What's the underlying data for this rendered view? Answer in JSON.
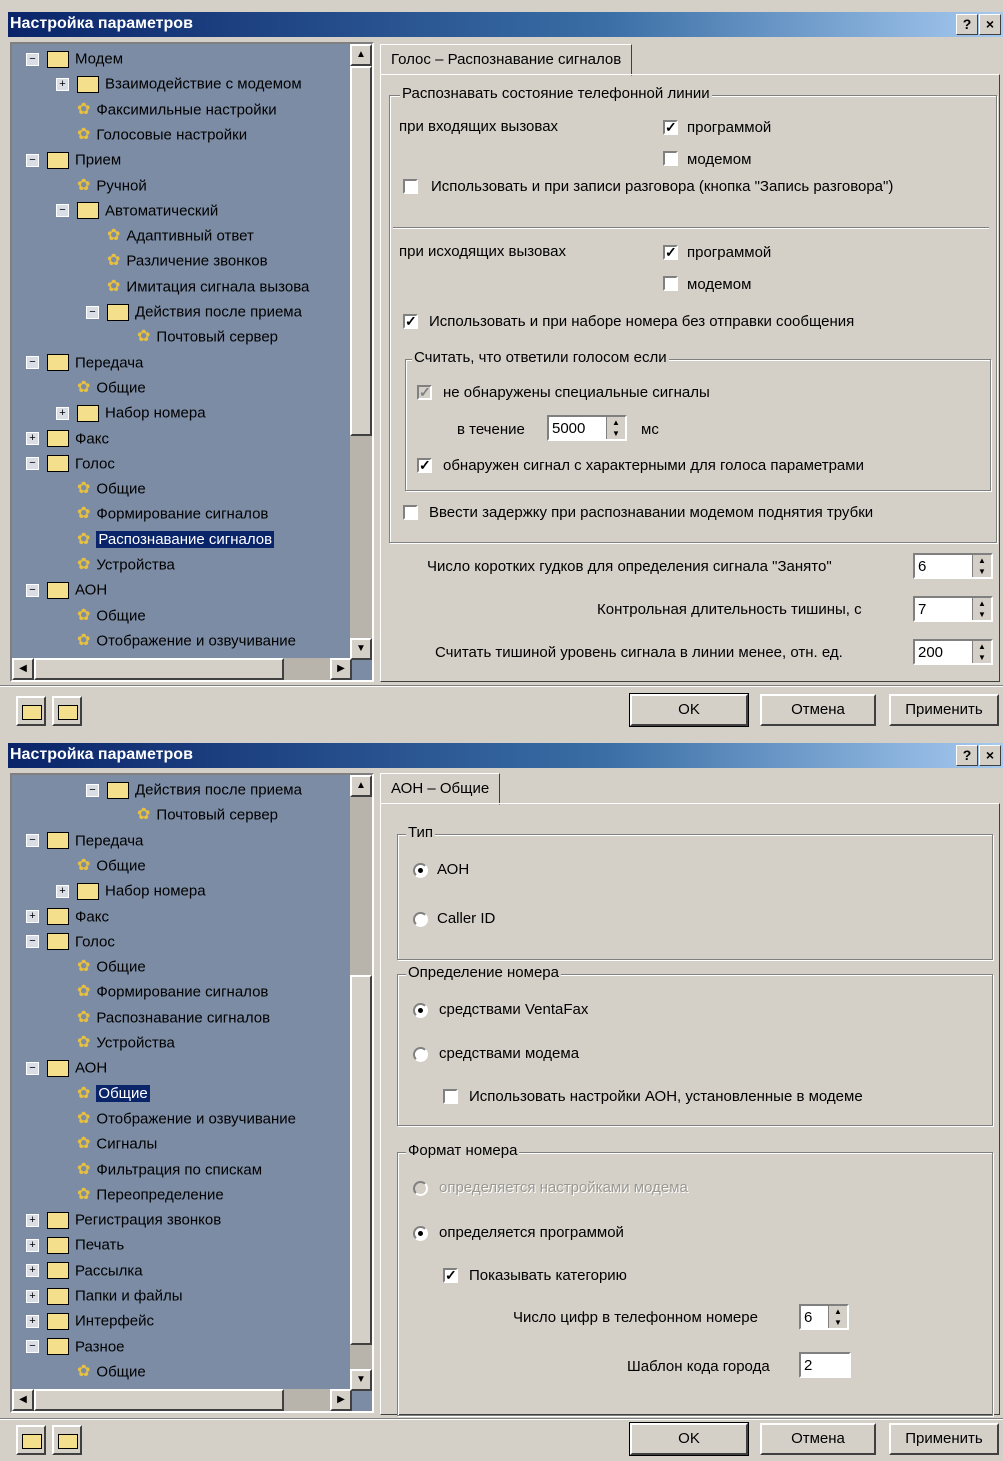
{
  "dialog1": {
    "title": "Настройка параметров",
    "help": "?",
    "close": "×",
    "tree": [
      {
        "label": "Модем",
        "level": 0,
        "exp": "−",
        "icon": "folder"
      },
      {
        "label": "Взаимодействие с модемом",
        "level": 1,
        "exp": "+",
        "icon": "folder"
      },
      {
        "label": "Факсимильные настройки",
        "level": 1,
        "icon": "gear"
      },
      {
        "label": "Голосовые настройки",
        "level": 1,
        "icon": "gear"
      },
      {
        "label": "Прием",
        "level": 0,
        "exp": "−",
        "icon": "folder"
      },
      {
        "label": "Ручной",
        "level": 1,
        "icon": "gear"
      },
      {
        "label": "Автоматический",
        "level": 1,
        "exp": "−",
        "icon": "folder"
      },
      {
        "label": "Адаптивный ответ",
        "level": 2,
        "icon": "gear"
      },
      {
        "label": "Различение звонков",
        "level": 2,
        "icon": "gear"
      },
      {
        "label": "Имитация сигнала вызова",
        "level": 2,
        "icon": "gear"
      },
      {
        "label": "Действия после приема",
        "level": 2,
        "exp": "−",
        "icon": "folder"
      },
      {
        "label": "Почтовый сервер",
        "level": 3,
        "icon": "gear"
      },
      {
        "label": "Передача",
        "level": 0,
        "exp": "−",
        "icon": "folder"
      },
      {
        "label": "Общие",
        "level": 1,
        "icon": "gear"
      },
      {
        "label": "Набор номера",
        "level": 1,
        "exp": "+",
        "icon": "folder"
      },
      {
        "label": "Факс",
        "level": 0,
        "exp": "+",
        "icon": "folder"
      },
      {
        "label": "Голос",
        "level": 0,
        "exp": "−",
        "icon": "folder"
      },
      {
        "label": "Общие",
        "level": 1,
        "icon": "gear"
      },
      {
        "label": "Формирование сигналов",
        "level": 1,
        "icon": "gear"
      },
      {
        "label": "Распознавание сигналов",
        "level": 1,
        "icon": "gear",
        "selected": true
      },
      {
        "label": "Устройства",
        "level": 1,
        "icon": "gear"
      },
      {
        "label": "АОН",
        "level": 0,
        "exp": "−",
        "icon": "folder"
      },
      {
        "label": "Общие",
        "level": 1,
        "icon": "gear"
      },
      {
        "label": "Отображение и озвучивание",
        "level": 1,
        "icon": "gear"
      }
    ],
    "tab": "Голос – Распознавание сигналов",
    "group_line": "Распознавать состояние телефонной линии",
    "incoming": "при входящих вызовах",
    "in_prog": "программой",
    "in_modem": "модемом",
    "use_recording": "Использовать и при записи разговора (кнопка \"Запись разговора\")",
    "outgoing": "при исходящих вызовах",
    "out_prog": "программой",
    "out_modem": "модемом",
    "use_dial": "Использовать и при наборе номера без отправки сообщения",
    "group_voice": "Считать, что ответили голосом если",
    "no_special": "не обнаружены специальные сигналы",
    "during": "в течение",
    "during_value": "5000",
    "ms": "мс",
    "voice_detected": "обнаружен сигнал с характерными для голоса параметрами",
    "delay": "Ввести задержку при распознавании модемом поднятия трубки",
    "short_beeps": "Число коротких гудков для определения сигнала \"Занято\"",
    "short_beeps_value": "6",
    "silence_dur": "Контрольная длительность тишины, с",
    "silence_dur_value": "7",
    "silence_level": "Считать тишиной уровень сигнала в линии менее, отн. ед.",
    "silence_level_value": "200",
    "ok": "OK",
    "cancel": "Отмена",
    "apply": "Применить"
  },
  "dialog2": {
    "title": "Настройка параметров",
    "help": "?",
    "close": "×",
    "tree": [
      {
        "label": "Действия после приема",
        "level": 2,
        "exp": "−",
        "icon": "folder"
      },
      {
        "label": "Почтовый сервер",
        "level": 3,
        "icon": "gear"
      },
      {
        "label": "Передача",
        "level": 0,
        "exp": "−",
        "icon": "folder"
      },
      {
        "label": "Общие",
        "level": 1,
        "icon": "gear"
      },
      {
        "label": "Набор номера",
        "level": 1,
        "exp": "+",
        "icon": "folder"
      },
      {
        "label": "Факс",
        "level": 0,
        "exp": "+",
        "icon": "folder"
      },
      {
        "label": "Голос",
        "level": 0,
        "exp": "−",
        "icon": "folder"
      },
      {
        "label": "Общие",
        "level": 1,
        "icon": "gear"
      },
      {
        "label": "Формирование сигналов",
        "level": 1,
        "icon": "gear"
      },
      {
        "label": "Распознавание сигналов",
        "level": 1,
        "icon": "gear"
      },
      {
        "label": "Устройства",
        "level": 1,
        "icon": "gear"
      },
      {
        "label": "АОН",
        "level": 0,
        "exp": "−",
        "icon": "folder"
      },
      {
        "label": "Общие",
        "level": 1,
        "icon": "gear",
        "selected": true
      },
      {
        "label": "Отображение и озвучивание",
        "level": 1,
        "icon": "gear"
      },
      {
        "label": "Сигналы",
        "level": 1,
        "icon": "gear"
      },
      {
        "label": "Фильтрация по спискам",
        "level": 1,
        "icon": "gear"
      },
      {
        "label": "Переопределение",
        "level": 1,
        "icon": "gear"
      },
      {
        "label": "Регистрация звонков",
        "level": 0,
        "exp": "+",
        "icon": "folder"
      },
      {
        "label": "Печать",
        "level": 0,
        "exp": "+",
        "icon": "folder"
      },
      {
        "label": "Рассылка",
        "level": 0,
        "exp": "+",
        "icon": "folder"
      },
      {
        "label": "Папки и файлы",
        "level": 0,
        "exp": "+",
        "icon": "folder"
      },
      {
        "label": "Интерфейс",
        "level": 0,
        "exp": "+",
        "icon": "folder"
      },
      {
        "label": "Разное",
        "level": 0,
        "exp": "−",
        "icon": "folder"
      },
      {
        "label": "Общие",
        "level": 1,
        "icon": "gear"
      }
    ],
    "tab": "АОН – Общие",
    "group_type": "Тип",
    "type_aon": "АОН",
    "type_callerid": "Caller ID",
    "group_detect": "Определение номера",
    "detect_ventafax": "средствами VentaFax",
    "detect_modem": "средствами модема",
    "use_modem_settings": "Использовать настройки АОН, установленные в модеме",
    "group_format": "Формат номера",
    "fmt_modem": "определяется настройками модема",
    "fmt_program": "определяется программой",
    "show_category": "Показывать категорию",
    "digits": "Число цифр в телефонном номере",
    "digits_value": "6",
    "area_code": "Шаблон кода города",
    "area_code_value": "2",
    "ok": "OK",
    "cancel": "Отмена",
    "apply": "Применить"
  }
}
